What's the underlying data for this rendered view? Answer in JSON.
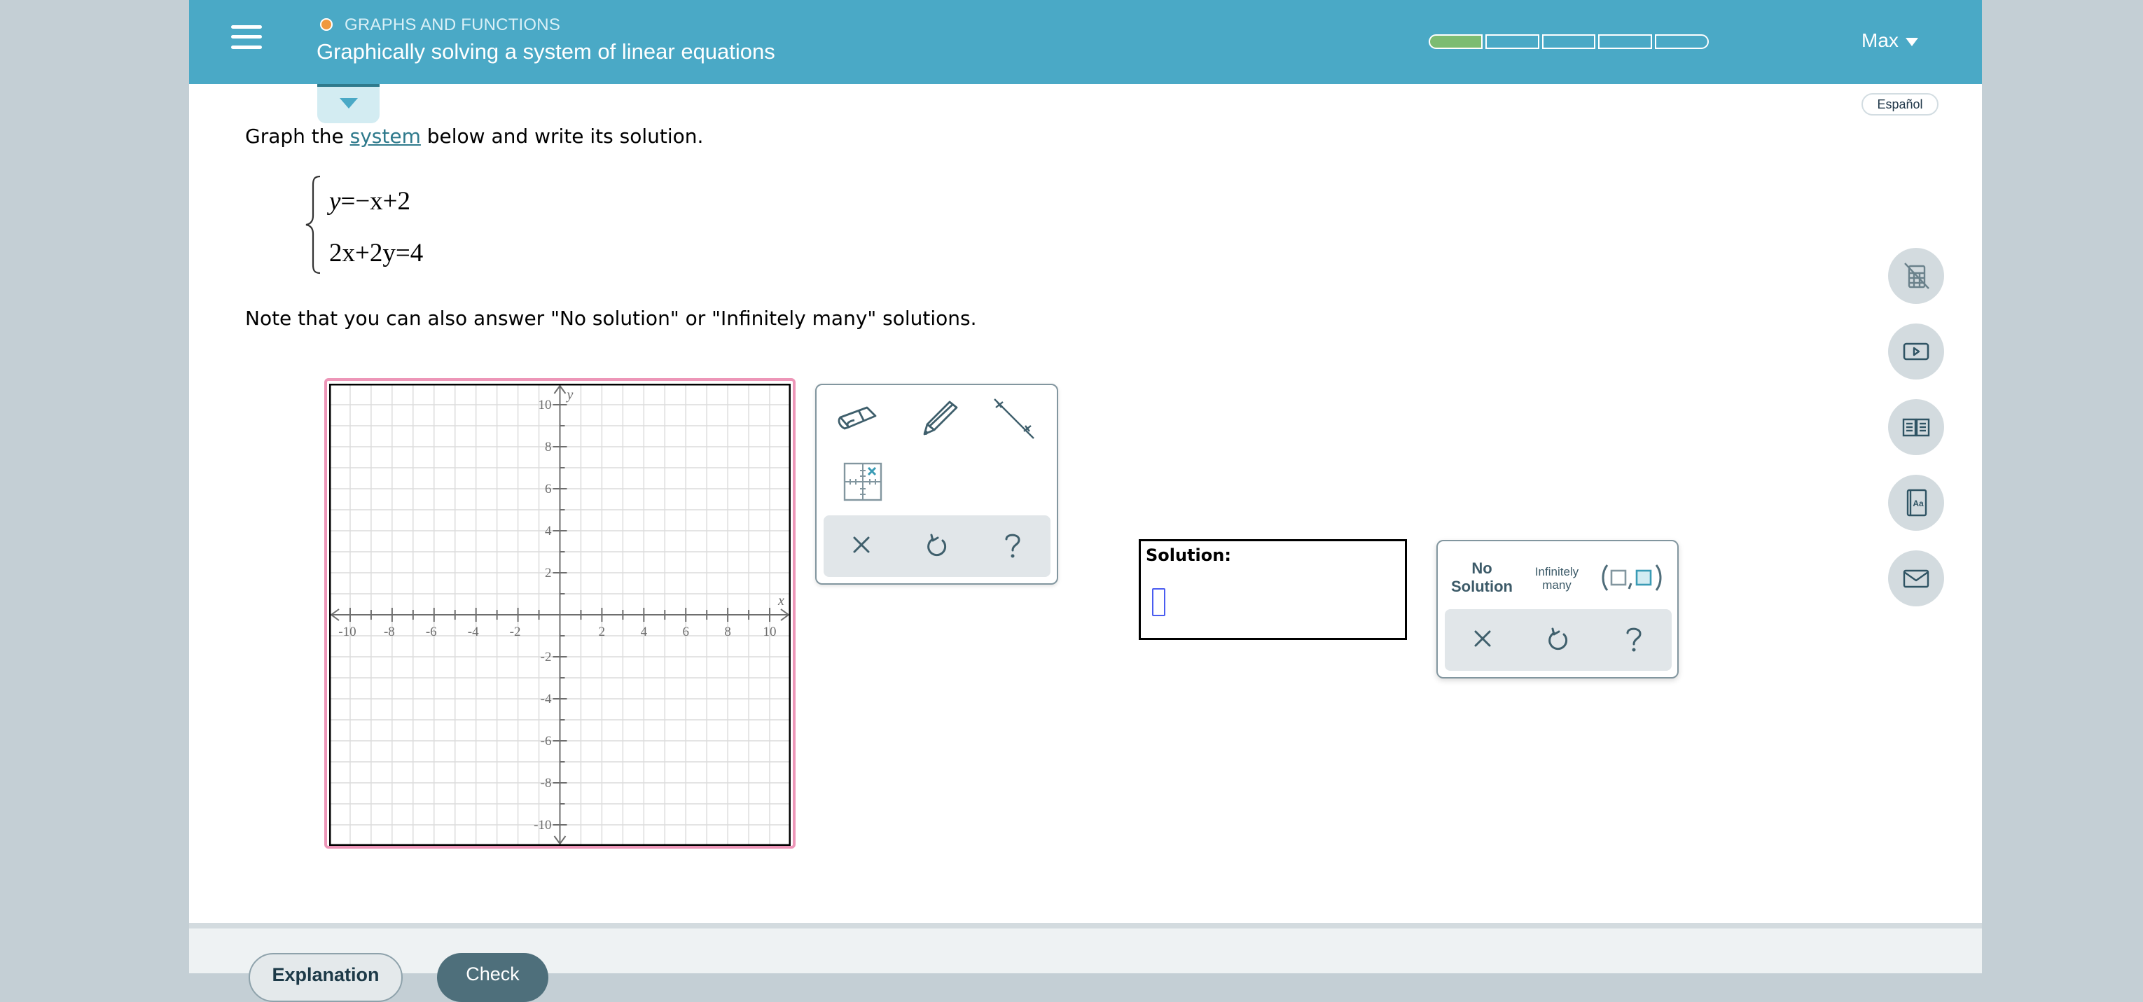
{
  "header": {
    "menu_icon": "hamburger-icon",
    "topic": "GRAPHS AND FUNCTIONS",
    "topic_status_color": "#f0983f",
    "title": "Graphically solving a system of linear equations",
    "progress": {
      "segments": 5,
      "completed": 1,
      "complete_color": "#7cbc72"
    },
    "user_name": "Max"
  },
  "language_button": "Español",
  "question": {
    "prompt_before": "Graph the ",
    "prompt_link": "system",
    "prompt_after": " below and write its solution.",
    "equations": [
      {
        "lhs": "y",
        "rhs": "−x+2"
      },
      {
        "lhs": "2x+2y",
        "rhs": "4"
      }
    ],
    "note": "Note that you can also answer \"No solution\" or \"Infinitely many\" solutions."
  },
  "graph": {
    "x_axis_label": "x",
    "y_axis_label": "y",
    "x_range": [
      -11,
      11
    ],
    "y_range": [
      -11,
      11
    ],
    "grid_step": 1,
    "x_tick_labels": [
      "-10",
      "-8",
      "-6",
      "-4",
      "-2",
      "2",
      "4",
      "6",
      "8",
      "10"
    ],
    "y_tick_labels": [
      "10",
      "8",
      "6",
      "4",
      "2",
      "-2",
      "-4",
      "-6",
      "-8",
      "-10"
    ],
    "focus_border_color": "#ed96b8"
  },
  "graph_tools": {
    "tools": [
      {
        "name": "eraser",
        "icon": "eraser-icon"
      },
      {
        "name": "pencil",
        "icon": "pencil-icon"
      },
      {
        "name": "line",
        "icon": "line-tool-icon"
      },
      {
        "name": "point",
        "icon": "point-on-grid-icon"
      }
    ],
    "actions": [
      {
        "name": "clear",
        "icon": "x-icon"
      },
      {
        "name": "undo",
        "icon": "undo-icon"
      },
      {
        "name": "help",
        "icon": "question-icon"
      }
    ]
  },
  "solution": {
    "label": "Solution:",
    "value": ""
  },
  "answer_palette": {
    "no_solution_line1": "No",
    "no_solution_line2": "Solution",
    "infinitely_line1": "Infinitely",
    "infinitely_line2": "many",
    "ordered_pair_icon": "ordered-pair-icon",
    "actions": [
      {
        "name": "clear",
        "icon": "x-icon"
      },
      {
        "name": "undo",
        "icon": "undo-icon"
      },
      {
        "name": "help",
        "icon": "question-icon"
      }
    ]
  },
  "side_tools": [
    {
      "name": "calculator-disabled",
      "icon": "calculator-off-icon"
    },
    {
      "name": "video",
      "icon": "video-play-icon"
    },
    {
      "name": "textbook",
      "icon": "open-book-icon"
    },
    {
      "name": "dictionary",
      "icon": "dictionary-icon"
    },
    {
      "name": "message",
      "icon": "envelope-icon"
    }
  ],
  "footer": {
    "explanation_label": "Explanation",
    "check_label": "Check"
  }
}
